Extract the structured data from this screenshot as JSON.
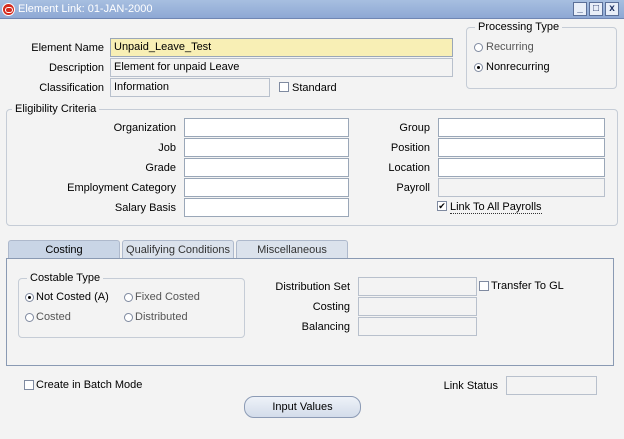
{
  "window": {
    "title": "Element Link: 01-JAN-2000",
    "controls": [
      "_",
      "□",
      "x"
    ]
  },
  "element": {
    "name_label": "Element Name",
    "name_value": "Unpaid_Leave_Test",
    "description_label": "Description",
    "description_value": "Element for unpaid Leave",
    "classification_label": "Classification",
    "classification_value": "Information",
    "standard_label": "Standard",
    "standard_checked": false
  },
  "processing": {
    "title": "Processing Type",
    "recurring": "Recurring",
    "nonrecurring": "Nonrecurring",
    "selected": "Nonrecurring"
  },
  "eligibility": {
    "title": "Eligibility Criteria",
    "left": [
      {
        "label": "Organization",
        "value": ""
      },
      {
        "label": "Job",
        "value": ""
      },
      {
        "label": "Grade",
        "value": ""
      },
      {
        "label": "Employment Category",
        "value": ""
      },
      {
        "label": "Salary Basis",
        "value": ""
      }
    ],
    "right": [
      {
        "label": "Group",
        "value": ""
      },
      {
        "label": "Position",
        "value": ""
      },
      {
        "label": "Location",
        "value": ""
      },
      {
        "label": "Payroll",
        "value": ""
      }
    ],
    "link_all_label": "Link To All Payrolls",
    "link_all_checked": true
  },
  "tabs": [
    {
      "label": "Costing",
      "active": true
    },
    {
      "label": "Qualifying Conditions",
      "active": false
    },
    {
      "label": "Miscellaneous",
      "active": false
    }
  ],
  "costing": {
    "type_title": "Costable Type",
    "not_costed": "Not Costed (A)",
    "fixed_costed": "Fixed Costed",
    "costed": "Costed",
    "distributed": "Distributed",
    "selected": "Not Costed (A)",
    "distribution_set_label": "Distribution Set",
    "distribution_set_value": "",
    "costing_label": "Costing",
    "costing_value": "",
    "balancing_label": "Balancing",
    "balancing_value": "",
    "transfer_gl_label": "Transfer To GL",
    "transfer_gl_checked": false
  },
  "footer": {
    "batch_mode_label": "Create in Batch Mode",
    "batch_mode_checked": false,
    "link_status_label": "Link Status",
    "link_status_value": "",
    "input_values_button": "Input Values"
  },
  "colors": {
    "titlebar": "#8ea8d4",
    "required_field": "#f8efb5",
    "background": "#f3f3f3"
  }
}
